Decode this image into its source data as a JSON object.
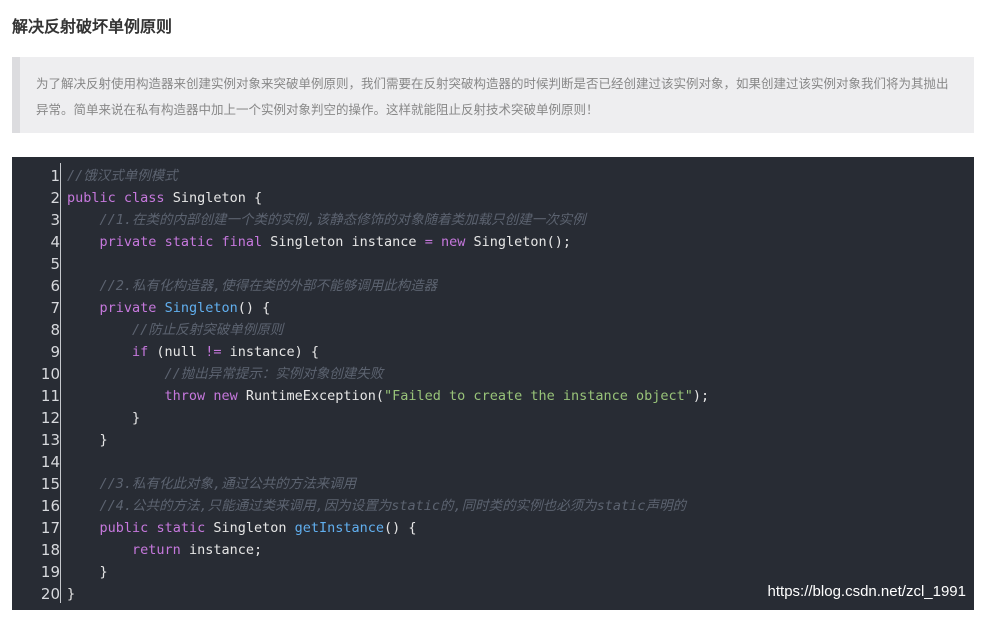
{
  "article": {
    "title": "解决反射破坏单例原则",
    "note": "为了解决反射使用构造器来创建实例对象来突破单例原则，我们需要在反射突破构造器的时候判断是否已经创建过该实例对象，如果创建过该实例对象我们将为其抛出异常。简单来说在私有构造器中加上一个实例对象判空的操作。这样就能阻止反射技术突破单例原则！"
  },
  "code": {
    "line_numbers": [
      "1",
      "2",
      "3",
      "4",
      "5",
      "6",
      "7",
      "8",
      "9",
      "10",
      "11",
      "12",
      "13",
      "14",
      "15",
      "16",
      "17",
      "18",
      "19",
      "20"
    ],
    "lines": [
      {
        "indent": "",
        "tokens": [
          {
            "t": "//饿汉式单例模式",
            "c": "c"
          }
        ]
      },
      {
        "indent": "",
        "tokens": [
          {
            "t": "public",
            "c": "k"
          },
          {
            "t": " "
          },
          {
            "t": "class",
            "c": "k"
          },
          {
            "t": " Singleton {"
          }
        ]
      },
      {
        "indent": "    ",
        "tokens": [
          {
            "t": "//1.在类的内部创建一个类的实例,该静态修饰的对象随着类加载只创建一次实例",
            "c": "c"
          }
        ]
      },
      {
        "indent": "    ",
        "tokens": [
          {
            "t": "private",
            "c": "k"
          },
          {
            "t": " "
          },
          {
            "t": "static",
            "c": "k"
          },
          {
            "t": " "
          },
          {
            "t": "final",
            "c": "k"
          },
          {
            "t": " Singleton instance "
          },
          {
            "t": "=",
            "c": "o"
          },
          {
            "t": " "
          },
          {
            "t": "new",
            "c": "k"
          },
          {
            "t": " Singleton();"
          }
        ]
      },
      {
        "indent": "",
        "tokens": []
      },
      {
        "indent": "    ",
        "tokens": [
          {
            "t": "//2.私有化构造器,使得在类的外部不能够调用此构造器",
            "c": "c"
          }
        ]
      },
      {
        "indent": "    ",
        "tokens": [
          {
            "t": "private",
            "c": "k"
          },
          {
            "t": " "
          },
          {
            "t": "Singleton",
            "c": "f"
          },
          {
            "t": "() {"
          }
        ]
      },
      {
        "indent": "        ",
        "tokens": [
          {
            "t": "//防止反射突破单例原则",
            "c": "c"
          }
        ]
      },
      {
        "indent": "        ",
        "tokens": [
          {
            "t": "if",
            "c": "k"
          },
          {
            "t": " (null "
          },
          {
            "t": "!=",
            "c": "o"
          },
          {
            "t": " instance) {"
          }
        ]
      },
      {
        "indent": "            ",
        "tokens": [
          {
            "t": "//抛出异常提示：实例对象创建失败",
            "c": "c"
          }
        ]
      },
      {
        "indent": "            ",
        "tokens": [
          {
            "t": "throw",
            "c": "k"
          },
          {
            "t": " "
          },
          {
            "t": "new",
            "c": "k"
          },
          {
            "t": " RuntimeException("
          },
          {
            "t": "\"Failed to create the instance object\"",
            "c": "s"
          },
          {
            "t": ");"
          }
        ]
      },
      {
        "indent": "        ",
        "tokens": [
          {
            "t": "}"
          }
        ]
      },
      {
        "indent": "    ",
        "tokens": [
          {
            "t": "}"
          }
        ]
      },
      {
        "indent": "",
        "tokens": []
      },
      {
        "indent": "    ",
        "tokens": [
          {
            "t": "//3.私有化此对象,通过公共的方法来调用",
            "c": "c"
          }
        ]
      },
      {
        "indent": "    ",
        "tokens": [
          {
            "t": "//4.公共的方法,只能通过类来调用,因为设置为static的,同时类的实例也必须为static声明的",
            "c": "c"
          }
        ]
      },
      {
        "indent": "    ",
        "tokens": [
          {
            "t": "public",
            "c": "k"
          },
          {
            "t": " "
          },
          {
            "t": "static",
            "c": "k"
          },
          {
            "t": " Singleton "
          },
          {
            "t": "getInstance",
            "c": "f"
          },
          {
            "t": "() {"
          }
        ]
      },
      {
        "indent": "        ",
        "tokens": [
          {
            "t": "return",
            "c": "k"
          },
          {
            "t": " instance;"
          }
        ]
      },
      {
        "indent": "    ",
        "tokens": [
          {
            "t": "}"
          }
        ]
      },
      {
        "indent": "",
        "tokens": [
          {
            "t": "}"
          }
        ]
      }
    ],
    "colors": {
      "background": "#282c34",
      "comment": "#5c6370",
      "keyword": "#c678dd",
      "function": "#61afef",
      "string": "#98c379",
      "text": "#e6e6e6"
    }
  },
  "watermark": "https://blog.csdn.net/zcl_1991"
}
